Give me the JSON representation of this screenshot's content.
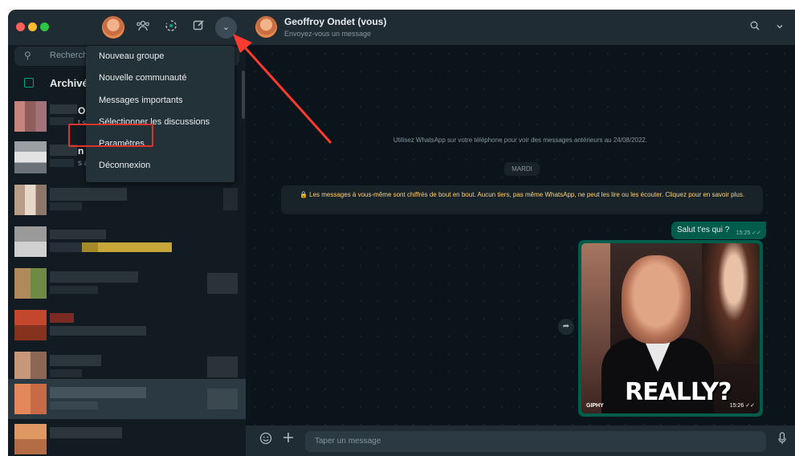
{
  "sidebar": {
    "search_placeholder": "Recherche",
    "archive_label": "Archivées",
    "partial_texts": [
      "Or",
      "t s",
      "n P",
      "s a"
    ]
  },
  "menu": {
    "items": [
      "Nouveau groupe",
      "Nouvelle communauté",
      "Messages importants",
      "Sélectionner les discussions",
      "Paramètres",
      "Déconnexion"
    ]
  },
  "conversation": {
    "contact_name": "Geoffroy Ondet (vous)",
    "contact_subtitle": "Envoyez-vous un message",
    "history_note": "Utilisez WhatsApp sur votre téléphone pour voir des messages antérieurs au 24/08/2022.",
    "day_label": "MARDI",
    "encryption_notice": "🔒 Les messages à vous-même sont chiffrés de bout en bout. Aucun tiers, pas même WhatsApp, ne peut les lire ou les écouter. Cliquez pour en savoir plus.",
    "messages": [
      {
        "text": "Salut t'es qui ?",
        "time": "15:25 ✓✓"
      }
    ],
    "gif": {
      "caption": "REALLY?",
      "source": "GIPHY",
      "time": "15:26 ✓✓"
    },
    "composer_placeholder": "Taper un message"
  },
  "icons": [
    "search-icon",
    "community-icon",
    "status-icon",
    "new-chat-icon",
    "chevron-down-icon",
    "archive-icon",
    "emoji-icon",
    "plus-icon",
    "mic-icon",
    "forward-icon"
  ],
  "colors": {
    "accent": "#00a884",
    "outgoing_bubble": "#005c4b",
    "highlight_box": "#e0332b",
    "annotation_arrow": "#ff3b30"
  }
}
